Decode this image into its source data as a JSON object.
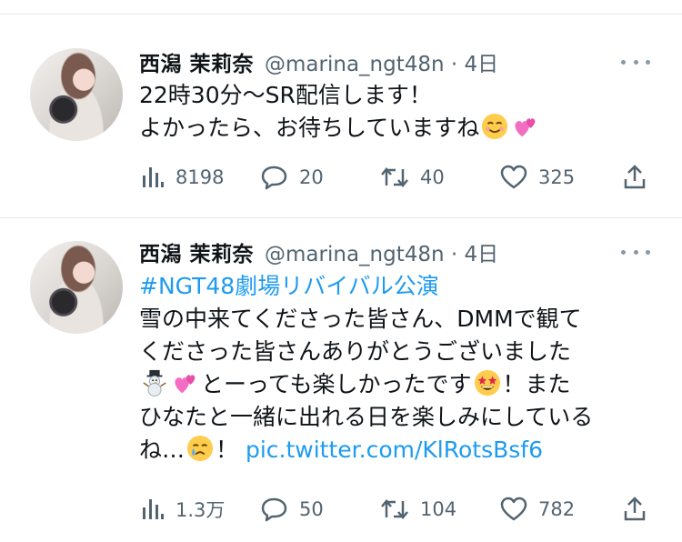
{
  "tweets": [
    {
      "author_name": "西潟 茉莉奈",
      "handle_time": "@marina_ngt48n · 4日",
      "lines": [
        {
          "text": "22時30分〜SR配信します！"
        },
        {
          "text": "よかったら、お待ちしていますね"
        }
      ],
      "counts": {
        "views": "8198",
        "replies": "20",
        "retweets": "40",
        "likes": "325"
      }
    },
    {
      "author_name": "西潟 茉莉奈",
      "handle_time": "@marina_ngt48n · 4日",
      "hashtag": "#NGT48劇場リバイバル公演",
      "lines": [
        {
          "text": "雪の中来てくださった皆さん、DMMで観て"
        },
        {
          "text": "くださった皆さんありがとうございました"
        },
        {
          "pre": "",
          "text": "とーっても楽しかったです",
          "post": "！また"
        },
        {
          "text": "ひなたと一緒に出れる日を楽しみにしている"
        },
        {
          "text": "ね…",
          "post": "！",
          "link": "pic.twitter.com/KlRotsBsf6"
        }
      ],
      "counts": {
        "views": "1.3万",
        "replies": "50",
        "retweets": "104",
        "likes": "782"
      }
    }
  ],
  "icons": [
    "views-icon",
    "reply-icon",
    "retweet-icon",
    "like-icon",
    "share-icon",
    "more-icon"
  ],
  "colors": {
    "text": "#0f1419",
    "secondary": "#536471",
    "link": "#1d9bf0",
    "divider": "#e6e8ea"
  }
}
